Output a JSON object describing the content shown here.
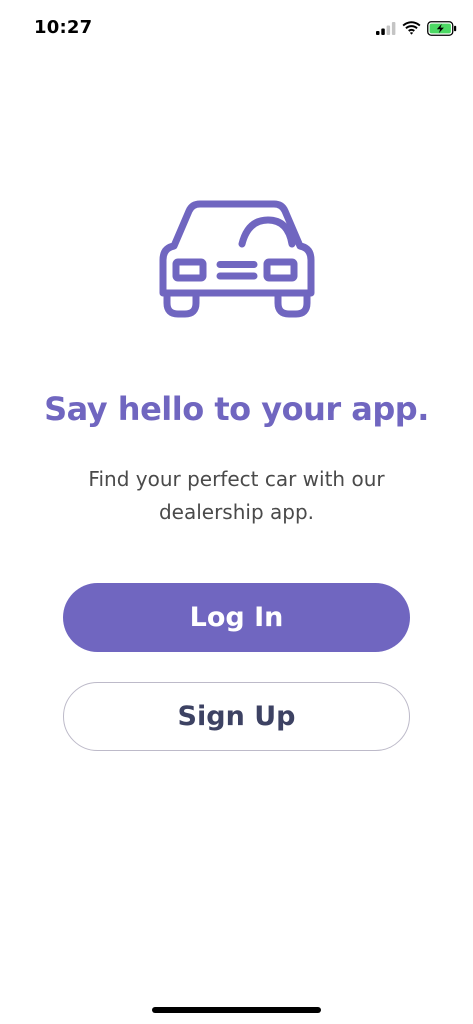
{
  "theme": {
    "accent": "#7066c0"
  },
  "status_bar": {
    "time": "10:27",
    "icons": [
      "cellular-signal-icon",
      "wifi-icon",
      "battery-charging-icon"
    ]
  },
  "hero": {
    "icon": "car-icon",
    "headline": "Say hello to your app.",
    "subtitle": "Find your perfect car with our dealership app."
  },
  "actions": {
    "login_label": "Log In",
    "signup_label": "Sign Up"
  }
}
